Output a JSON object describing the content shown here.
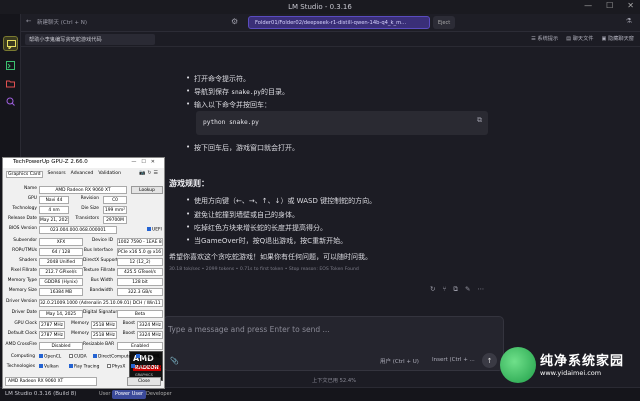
{
  "app": {
    "title": "LM Studio - 0.3.16"
  },
  "topbar": {
    "new_chat": "新建聊天 (Ctrl + N)",
    "model": "Folder01/Folder02/deepseek-r1-distill-qwen-14b-q4_k_m...",
    "eject": "Eject"
  },
  "chatbar": {
    "tab": "帮助小李鬼编写贪吃蛇游戏代码",
    "sys_prompt": "系统提示",
    "chat_settings": "聊天文件",
    "hide": "隐藏聊天窗"
  },
  "message": {
    "steps": [
      "打开命令提示符。",
      "导航到保存 ",
      "的目录。",
      "输入以下命令并按回车："
    ],
    "file": "snake.py",
    "code": "python snake.py",
    "step_last": "按下回车后，游戏窗口就会打开。",
    "rules_title": "游戏规则：",
    "rules": [
      "使用方向键（←、→、↑、↓）或 WASD 键控制蛇的方向。",
      "避免让蛇撞到墙壁或自己的身体。",
      "吃掉红色方块来增长蛇的长度并提高得分。",
      "当GameOver时，按Q退出游戏，按C重新开始。"
    ],
    "closing": "希望你喜欢这个贪吃蛇游戏！如果你有任何问题，可以随时问我。",
    "stats": "30.18 tok/sec • 2099 tokens • 0.71s to first token • Stop reason: EOS Token Found"
  },
  "input": {
    "placeholder": "Type a message and press Enter to send ...",
    "user_btn": "用户 (Ctrl + U)",
    "insert_btn": "Insert (Ctrl + ...",
    "context": "上下文已用 52.4%"
  },
  "statusbar": {
    "app": "LM Studio 0.3.16 (Build 8)",
    "modes": [
      "User",
      "Power User",
      "Developer"
    ]
  },
  "gpuz": {
    "title": "TechPowerUp GPU-Z 2.66.0",
    "tabs": [
      "Graphics Card",
      "Sensors",
      "Advanced",
      "Validation"
    ],
    "rows": [
      {
        "l": "Name",
        "v": "AMD Radeon RX 9060 XT",
        "b": "Lookup"
      },
      {
        "l": "GPU",
        "v": "Navi 44",
        "l2": "Revision",
        "v2": "C0"
      },
      {
        "l": "Technology",
        "v": "4 nm",
        "l2": "Die Size",
        "v2": "199 mm²"
      },
      {
        "l": "Release Date",
        "v": "May 21, 2025",
        "l2": "Transistors",
        "v2": "29700M"
      },
      {
        "l": "BIOS Version",
        "v": "023.004.000.068.000001",
        "b": "UEFI"
      },
      {
        "l": "Subvendor",
        "v": "XFX",
        "l2": "Device ID",
        "v2": "1002 7590 - 1EAE 8601"
      },
      {
        "l": "ROPs/TMUs",
        "v": "64 / 128",
        "l2": "Bus Interface",
        "v2": "PCIe x16 5.0 @ x16 5.0"
      },
      {
        "l": "Shaders",
        "v": "2048 Unified",
        "l2": "DirectX Support",
        "v2": "12 (12_2)"
      },
      {
        "l": "Pixel Fillrate",
        "v": "212.7 GPixel/s",
        "l2": "Texture Fillrate",
        "v2": "425.5 GTexel/s"
      },
      {
        "l": "Memory Type",
        "v": "GDDR6 (Hynix)",
        "l2": "Bus Width",
        "v2": "128 bit"
      },
      {
        "l": "Memory Size",
        "v": "16384 MB",
        "l2": "Bandwidth",
        "v2": "322.3 GB/s"
      },
      {
        "l": "Driver Version",
        "v": "32.0.21009.1000 (Adrenalin 25.10.09.01) DCH / Win11 64"
      },
      {
        "l": "Driver Date",
        "v": "May 14, 2025",
        "l2": "Digital Signature",
        "v2": "Beta"
      },
      {
        "l": "GPU Clock",
        "v": "2787 MHz",
        "l2": "Memory",
        "v2": "2518 MHz",
        "l3": "Boost",
        "v3": "3324 MHz"
      },
      {
        "l": "Default Clock",
        "v": "2787 MHz",
        "l2": "Memory",
        "v2": "2518 MHz",
        "l3": "Boost",
        "v3": "3324 MHz"
      },
      {
        "l": "AMD CrossFire",
        "v": "Disabled",
        "l2": "Resizable BAR",
        "v2": "Enabled"
      }
    ],
    "computing_label": "Computing",
    "computing": [
      "OpenCL",
      "CUDA",
      "DirectCompute",
      "DirectML"
    ],
    "tech_label": "Technologies",
    "tech": [
      "Vulkan",
      "Ray Tracing",
      "PhysX",
      "OpenGL 4.6"
    ],
    "select": "AMD Radeon RX 9060 XT",
    "close": "Close",
    "amd_logo": "AMD",
    "radeon": "RADEON",
    "graphics": "GRAPHICS"
  },
  "watermark": {
    "t1": "纯净系统家园",
    "t2": "www.yidaimei.com"
  }
}
